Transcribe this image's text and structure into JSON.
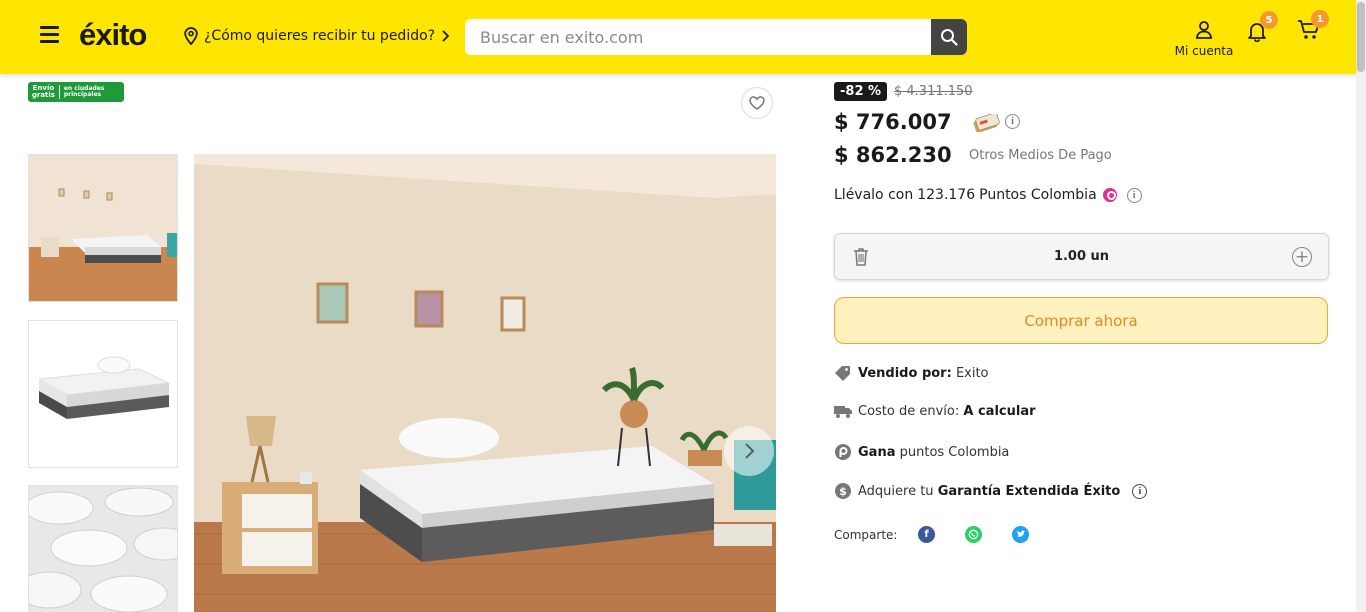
{
  "header": {
    "logo_text": "éxito",
    "location_prompt": "¿Cómo quieres recibir tu pedido?",
    "search_placeholder": "Buscar en exito.com",
    "account_label": "Mi cuenta",
    "notifications_count": "5",
    "cart_count": "1",
    "brand_yellow": "#ffe600"
  },
  "gallery": {
    "shipping_badge_left": "Envío gratis",
    "shipping_badge_right": "en ciudades principales",
    "thumbnails": [
      "bedroom-scene",
      "mattress-isolated",
      "mattress-texture-closeup"
    ]
  },
  "product": {
    "discount": "-82 %",
    "old_price": "$ 4.311.150",
    "card_price": "$ 776.007",
    "other_price": "$ 862.230",
    "other_payment_label": "Otros Medios De Pago",
    "points_prefix": "Llévalo con",
    "points_value": "123.176",
    "points_suffix": "Puntos Colombia",
    "quantity": "1.00 un",
    "buy_button": "Comprar ahora",
    "sold_by_label": "Vendido por:",
    "sold_by_value": "Exito",
    "shipping_label": "Costo de envío:",
    "shipping_value": "A calcular",
    "earn_label": "Gana",
    "earn_suffix": "puntos Colombia",
    "warranty_prefix": "Adquiere tu",
    "warranty_value": "Garantía Extendida Éxito",
    "share_label": "Comparte:"
  }
}
